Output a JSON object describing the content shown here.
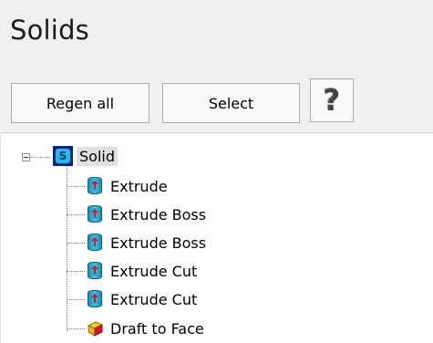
{
  "panel": {
    "title": "Solids"
  },
  "toolbar": {
    "regen_label": "Regen all",
    "select_label": "Select",
    "help_label": "?"
  },
  "tree": {
    "root": {
      "label": "Solid",
      "icon_letter": "S",
      "icon": "solid-body-icon",
      "expanded": true
    },
    "items": [
      {
        "label": "Extrude",
        "icon": "extrude-feature-icon"
      },
      {
        "label": "Extrude Boss",
        "icon": "extrude-feature-icon"
      },
      {
        "label": "Extrude Boss",
        "icon": "extrude-feature-icon"
      },
      {
        "label": "Extrude Cut",
        "icon": "extrude-feature-icon"
      },
      {
        "label": "Extrude Cut",
        "icon": "extrude-feature-icon"
      },
      {
        "label": "Draft to Face",
        "icon": "draft-feature-icon"
      }
    ]
  },
  "colors": {
    "panel_bg": "#f0f0f0",
    "tree_bg": "#ffffff",
    "root_icon_bg": "#0a1f8a",
    "feature_icon": "#2ec6e6",
    "arrow": "#e0122a"
  }
}
